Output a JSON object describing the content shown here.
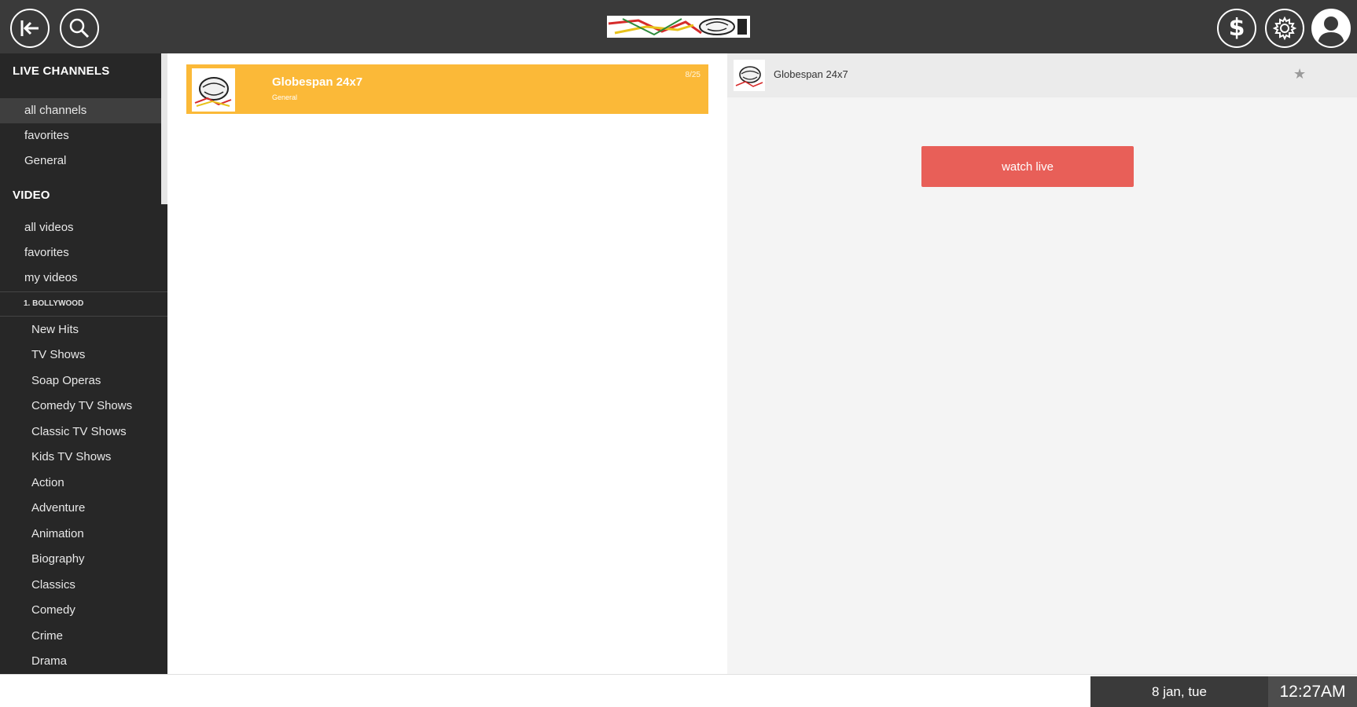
{
  "topbar": {
    "icons": {
      "back": "exit-arrow-icon",
      "search": "search-icon",
      "dollar": "dollar-icon",
      "settings": "gear-icon",
      "user": "user-icon"
    },
    "dollar_glyph": "$"
  },
  "sidebar": {
    "live_header": "LIVE CHANNELS",
    "live_items": [
      {
        "label": "all channels",
        "active": true
      },
      {
        "label": "favorites",
        "active": false
      },
      {
        "label": "General",
        "active": false
      }
    ],
    "video_header": "VIDEO",
    "video_items": [
      {
        "label": "all videos"
      },
      {
        "label": "favorites"
      },
      {
        "label": "my videos"
      }
    ],
    "group_header": "1. BOLLYWOOD",
    "group_items": [
      "New Hits",
      "TV Shows",
      "Soap Operas",
      "Comedy TV Shows",
      "Classic TV Shows",
      "Kids TV Shows",
      "Action",
      "Adventure",
      "Animation",
      "Biography",
      "Classics",
      "Comedy",
      "Crime",
      "Drama"
    ]
  },
  "channel_list": {
    "items": [
      {
        "name": "Globespan 24x7",
        "category": "General",
        "badge": "8/25"
      }
    ]
  },
  "detail": {
    "channel_name": "Globespan 24x7",
    "star_glyph": "★",
    "watch_label": "watch live"
  },
  "statusbar": {
    "date": "8 jan, tue",
    "time": "12:27AM"
  },
  "colors": {
    "topbar": "#3a3a3a",
    "sidebar": "#272727",
    "card": "#fbb938",
    "watch_button": "#e85f58"
  }
}
